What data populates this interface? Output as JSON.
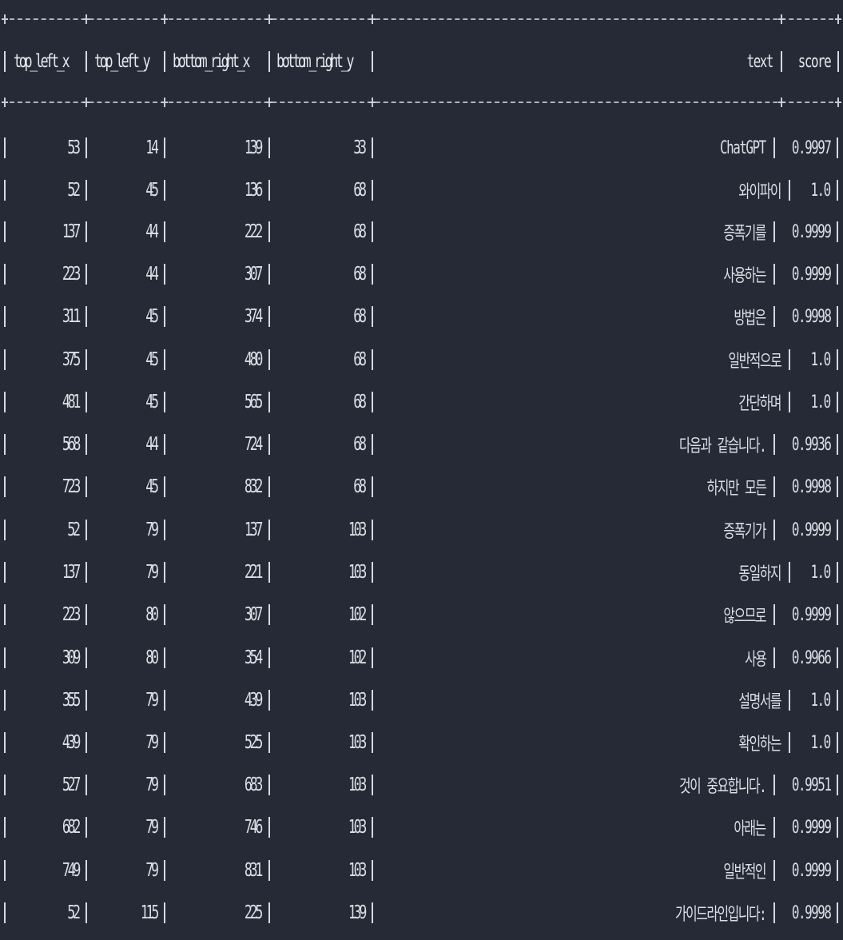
{
  "columns": [
    "top_left_x",
    "top_left_y",
    "bottom_right_x",
    "bottom_right_y",
    "text",
    "score"
  ],
  "rows": [
    {
      "top_left_x": "53",
      "top_left_y": "14",
      "bottom_right_x": "139",
      "bottom_right_y": "33",
      "text": "ChatGPT",
      "score": "0.9997"
    },
    {
      "top_left_x": "52",
      "top_left_y": "45",
      "bottom_right_x": "136",
      "bottom_right_y": "68",
      "text": "와이파이",
      "score": "1.0"
    },
    {
      "top_left_x": "137",
      "top_left_y": "44",
      "bottom_right_x": "222",
      "bottom_right_y": "68",
      "text": "증폭기를",
      "score": "0.9999"
    },
    {
      "top_left_x": "223",
      "top_left_y": "44",
      "bottom_right_x": "307",
      "bottom_right_y": "68",
      "text": "사용하는",
      "score": "0.9999"
    },
    {
      "top_left_x": "311",
      "top_left_y": "45",
      "bottom_right_x": "374",
      "bottom_right_y": "68",
      "text": "방법은",
      "score": "0.9998"
    },
    {
      "top_left_x": "375",
      "top_left_y": "45",
      "bottom_right_x": "480",
      "bottom_right_y": "68",
      "text": "일반적으로",
      "score": "1.0"
    },
    {
      "top_left_x": "481",
      "top_left_y": "45",
      "bottom_right_x": "565",
      "bottom_right_y": "68",
      "text": "간단하며",
      "score": "1.0"
    },
    {
      "top_left_x": "568",
      "top_left_y": "44",
      "bottom_right_x": "724",
      "bottom_right_y": "68",
      "text": "다음과 같습니다.",
      "score": "0.9936"
    },
    {
      "top_left_x": "723",
      "top_left_y": "45",
      "bottom_right_x": "832",
      "bottom_right_y": "68",
      "text": "하지만 모든",
      "score": "0.9998"
    },
    {
      "top_left_x": "52",
      "top_left_y": "79",
      "bottom_right_x": "137",
      "bottom_right_y": "103",
      "text": "증폭기가",
      "score": "0.9999"
    },
    {
      "top_left_x": "137",
      "top_left_y": "79",
      "bottom_right_x": "221",
      "bottom_right_y": "103",
      "text": "동일하지",
      "score": "1.0"
    },
    {
      "top_left_x": "223",
      "top_left_y": "80",
      "bottom_right_x": "307",
      "bottom_right_y": "102",
      "text": "않으므로",
      "score": "0.9999"
    },
    {
      "top_left_x": "309",
      "top_left_y": "80",
      "bottom_right_x": "354",
      "bottom_right_y": "102",
      "text": "사용",
      "score": "0.9966"
    },
    {
      "top_left_x": "355",
      "top_left_y": "79",
      "bottom_right_x": "439",
      "bottom_right_y": "103",
      "text": "설명서를",
      "score": "1.0"
    },
    {
      "top_left_x": "439",
      "top_left_y": "79",
      "bottom_right_x": "525",
      "bottom_right_y": "103",
      "text": "확인하는",
      "score": "1.0"
    },
    {
      "top_left_x": "527",
      "top_left_y": "79",
      "bottom_right_x": "683",
      "bottom_right_y": "103",
      "text": "것이 중요합니다.",
      "score": "0.9951"
    },
    {
      "top_left_x": "682",
      "top_left_y": "79",
      "bottom_right_x": "746",
      "bottom_right_y": "103",
      "text": "아래는",
      "score": "0.9999"
    },
    {
      "top_left_x": "749",
      "top_left_y": "79",
      "bottom_right_x": "831",
      "bottom_right_y": "103",
      "text": "일반적인",
      "score": "0.9999"
    },
    {
      "top_left_x": "52",
      "top_left_y": "115",
      "bottom_right_x": "225",
      "bottom_right_y": "139",
      "text": "가이드라인입니다:",
      "score": "0.9998"
    }
  ],
  "theme": {
    "background": "#262a36",
    "foreground": "#dcdfe6"
  }
}
